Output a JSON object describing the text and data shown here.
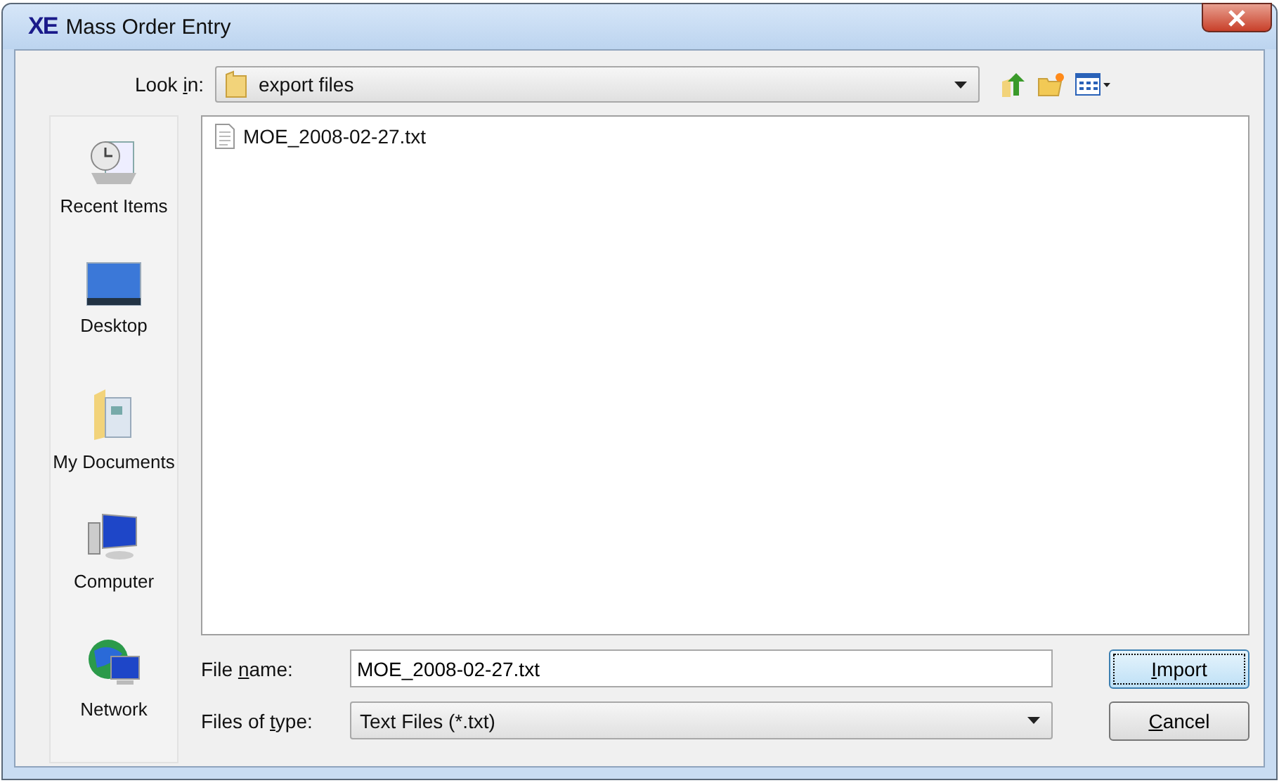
{
  "window": {
    "title": "Mass Order Entry",
    "logo": "XE"
  },
  "look_in": {
    "label": {
      "pre": "Look ",
      "key": "i",
      "post": "n:"
    },
    "value": "export files"
  },
  "places": [
    {
      "kind": "recent",
      "label": "Recent Items"
    },
    {
      "kind": "desktop",
      "label": "Desktop"
    },
    {
      "kind": "documents",
      "label": "My Documents"
    },
    {
      "kind": "computer",
      "label": "Computer"
    },
    {
      "kind": "network",
      "label": "Network"
    }
  ],
  "files": [
    {
      "name": "MOE_2008-02-27.txt",
      "selected": false
    }
  ],
  "file_name": {
    "label": {
      "pre": "File ",
      "key": "n",
      "post": "ame:"
    },
    "value": "MOE_2008-02-27.txt"
  },
  "file_type": {
    "label": {
      "pre": "Files of ",
      "key": "t",
      "post": "ype:"
    },
    "value": "Text Files (*.txt)"
  },
  "buttons": [
    {
      "label": {
        "key": "I",
        "post": "mport"
      },
      "default": true
    },
    {
      "label": {
        "key": "C",
        "post": "ancel"
      },
      "default": false
    }
  ]
}
